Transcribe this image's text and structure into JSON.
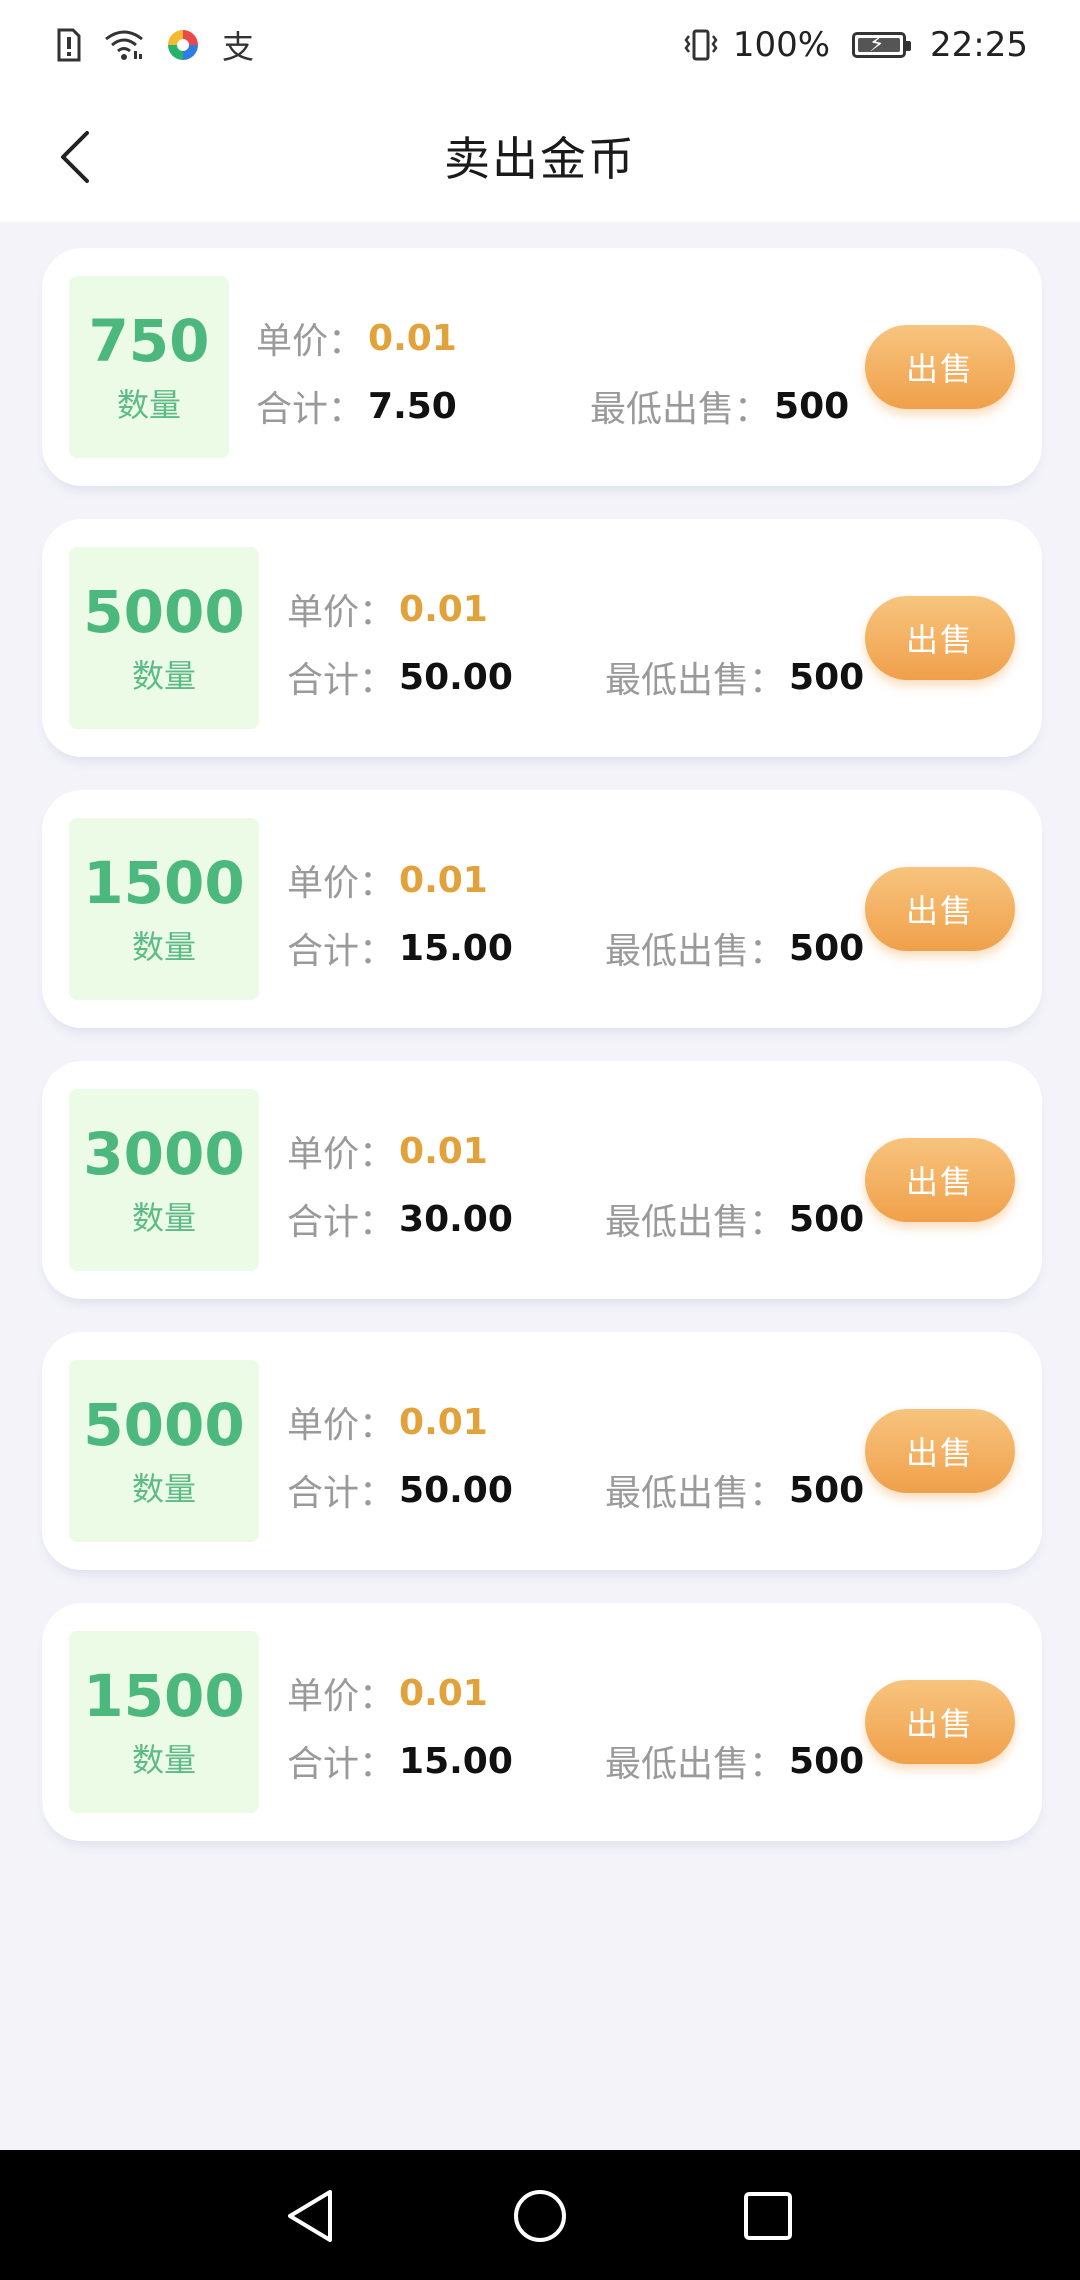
{
  "status_bar": {
    "time": "22:25",
    "battery_percent": "100%",
    "left_icons": [
      "alert-sim-icon",
      "wifi-icon",
      "app-icon",
      "alipay-icon"
    ],
    "alipay_glyph": "支"
  },
  "header": {
    "title": "卖出金币"
  },
  "labels": {
    "qty": "数量",
    "unit_price": "单价：",
    "total": "合计：",
    "min_sell": "最低出售：",
    "sell": "出售"
  },
  "listings": [
    {
      "quantity": "750",
      "unit_price": "0.01",
      "total": "7.50",
      "min_sell": "500"
    },
    {
      "quantity": "5000",
      "unit_price": "0.01",
      "total": "50.00",
      "min_sell": "500"
    },
    {
      "quantity": "1500",
      "unit_price": "0.01",
      "total": "15.00",
      "min_sell": "500"
    },
    {
      "quantity": "3000",
      "unit_price": "0.01",
      "total": "30.00",
      "min_sell": "500"
    },
    {
      "quantity": "5000",
      "unit_price": "0.01",
      "total": "50.00",
      "min_sell": "500"
    },
    {
      "quantity": "1500",
      "unit_price": "0.01",
      "total": "15.00",
      "min_sell": "500"
    }
  ],
  "colors": {
    "qty_green": "#4cb87e",
    "price_orange": "#e2a23b",
    "button_orange": "#f0a04a",
    "qty_bg": "#ecfbe5"
  }
}
